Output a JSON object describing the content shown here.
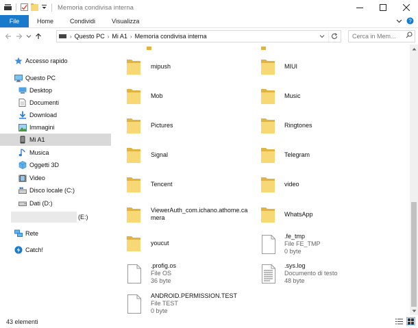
{
  "window": {
    "title": "Memoria condivisa interna"
  },
  "ribbon": {
    "file_tab": "File",
    "tabs": [
      "Home",
      "Condividi",
      "Visualizza"
    ]
  },
  "address": {
    "crumbs": [
      "Questo PC",
      "Mi A1",
      "Memoria condivisa interna"
    ]
  },
  "search": {
    "placeholder": "Cerca in Mem..."
  },
  "nav": {
    "quick_access": "Accesso rapido",
    "this_pc": "Questo PC",
    "items": [
      "Desktop",
      "Documenti",
      "Download",
      "Immagini",
      "Mi A1",
      "Musica",
      "Oggetti 3D",
      "Video",
      "Disco locale (C:)",
      "Dati (D:)"
    ],
    "drive_e": "(E:)",
    "network": "Rete",
    "catch": "Catch!"
  },
  "content": {
    "folders": [
      "mipush",
      "MIUI",
      "Mob",
      "Music",
      "Pictures",
      "Ringtones",
      "Signal",
      "Telegram",
      "Tencent",
      "video",
      "ViewerAuth_com.ichano.athome.camera",
      "WhatsApp",
      "youcut"
    ],
    "files": [
      {
        "name": ".fe_tmp",
        "type": "File FE_TMP",
        "size": "0 byte"
      },
      {
        "name": ".profig.os",
        "type": "File OS",
        "size": "36 byte"
      },
      {
        "name": ".sys.log",
        "type": "Documento di testo",
        "size": "48 byte"
      },
      {
        "name": "ANDROID.PERMISSION.TEST",
        "type": "File TEST",
        "size": "0 byte"
      }
    ]
  },
  "status": {
    "count": "43 elementi"
  },
  "colors": {
    "accent": "#1979ca",
    "folder": "#f8d775",
    "selection": "#d9d9d9"
  }
}
